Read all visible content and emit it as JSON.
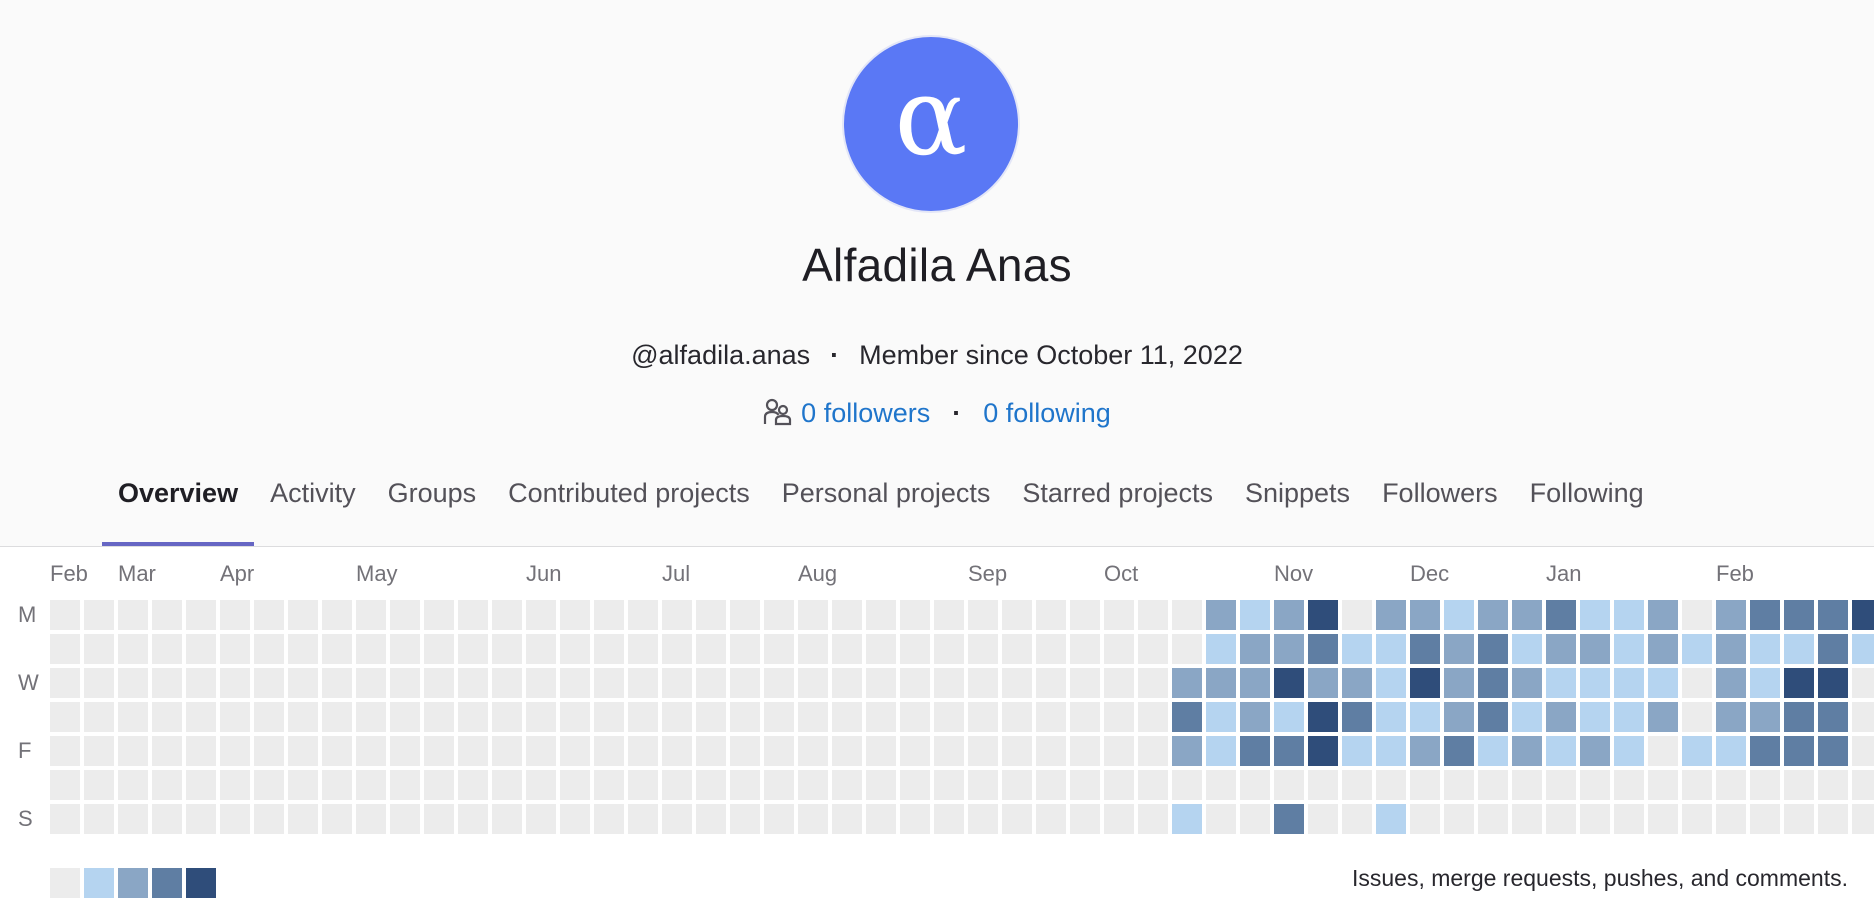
{
  "profile": {
    "avatar_letter": "α",
    "avatar_color": "#5a78f5",
    "name": "Alfadila Anas",
    "username": "@alfadila.anas",
    "member_since": "Member since October 11, 2022",
    "followers": "0 followers",
    "following": "0 following"
  },
  "tabs": [
    {
      "label": "Overview",
      "active": true
    },
    {
      "label": "Activity"
    },
    {
      "label": "Groups"
    },
    {
      "label": "Contributed projects"
    },
    {
      "label": "Personal projects"
    },
    {
      "label": "Starred projects"
    },
    {
      "label": "Snippets"
    },
    {
      "label": "Followers"
    },
    {
      "label": "Following"
    }
  ],
  "calendar": {
    "months": [
      {
        "label": "Feb",
        "week": 0
      },
      {
        "label": "Mar",
        "week": 2
      },
      {
        "label": "Apr",
        "week": 5
      },
      {
        "label": "May",
        "week": 9
      },
      {
        "label": "Jun",
        "week": 14
      },
      {
        "label": "Jul",
        "week": 18
      },
      {
        "label": "Aug",
        "week": 22
      },
      {
        "label": "Sep",
        "week": 27
      },
      {
        "label": "Oct",
        "week": 31
      },
      {
        "label": "Nov",
        "week": 36
      },
      {
        "label": "Dec",
        "week": 40
      },
      {
        "label": "Jan",
        "week": 44
      },
      {
        "label": "Feb",
        "week": 49
      }
    ],
    "day_labels": [
      {
        "label": "M",
        "row": 0
      },
      {
        "label": "W",
        "row": 2
      },
      {
        "label": "F",
        "row": 4
      },
      {
        "label": "S",
        "row": 6
      }
    ],
    "level_colors": [
      "#ececec",
      "#b5d4f0",
      "#8aa6c5",
      "#5f7ea3",
      "#2f4d7a"
    ],
    "levels_by_week": [
      [
        0,
        0,
        0,
        0,
        0,
        0,
        0
      ],
      [
        0,
        0,
        0,
        0,
        0,
        0,
        0
      ],
      [
        0,
        0,
        0,
        0,
        0,
        0,
        0
      ],
      [
        0,
        0,
        0,
        0,
        0,
        0,
        0
      ],
      [
        0,
        0,
        0,
        0,
        0,
        0,
        0
      ],
      [
        0,
        0,
        0,
        0,
        0,
        0,
        0
      ],
      [
        0,
        0,
        0,
        0,
        0,
        0,
        0
      ],
      [
        0,
        0,
        0,
        0,
        0,
        0,
        0
      ],
      [
        0,
        0,
        0,
        0,
        0,
        0,
        0
      ],
      [
        0,
        0,
        0,
        0,
        0,
        0,
        0
      ],
      [
        0,
        0,
        0,
        0,
        0,
        0,
        0
      ],
      [
        0,
        0,
        0,
        0,
        0,
        0,
        0
      ],
      [
        0,
        0,
        0,
        0,
        0,
        0,
        0
      ],
      [
        0,
        0,
        0,
        0,
        0,
        0,
        0
      ],
      [
        0,
        0,
        0,
        0,
        0,
        0,
        0
      ],
      [
        0,
        0,
        0,
        0,
        0,
        0,
        0
      ],
      [
        0,
        0,
        0,
        0,
        0,
        0,
        0
      ],
      [
        0,
        0,
        0,
        0,
        0,
        0,
        0
      ],
      [
        0,
        0,
        0,
        0,
        0,
        0,
        0
      ],
      [
        0,
        0,
        0,
        0,
        0,
        0,
        0
      ],
      [
        0,
        0,
        0,
        0,
        0,
        0,
        0
      ],
      [
        0,
        0,
        0,
        0,
        0,
        0,
        0
      ],
      [
        0,
        0,
        0,
        0,
        0,
        0,
        0
      ],
      [
        0,
        0,
        0,
        0,
        0,
        0,
        0
      ],
      [
        0,
        0,
        0,
        0,
        0,
        0,
        0
      ],
      [
        0,
        0,
        0,
        0,
        0,
        0,
        0
      ],
      [
        0,
        0,
        0,
        0,
        0,
        0,
        0
      ],
      [
        0,
        0,
        0,
        0,
        0,
        0,
        0
      ],
      [
        0,
        0,
        0,
        0,
        0,
        0,
        0
      ],
      [
        0,
        0,
        0,
        0,
        0,
        0,
        0
      ],
      [
        0,
        0,
        0,
        0,
        0,
        0,
        0
      ],
      [
        0,
        0,
        0,
        0,
        0,
        0,
        0
      ],
      [
        0,
        0,
        0,
        0,
        0,
        0,
        0
      ],
      [
        0,
        0,
        2,
        3,
        2,
        0,
        1
      ],
      [
        2,
        1,
        2,
        1,
        1,
        0,
        0
      ],
      [
        1,
        2,
        2,
        2,
        3,
        0,
        0
      ],
      [
        2,
        2,
        4,
        1,
        3,
        0,
        3
      ],
      [
        4,
        3,
        2,
        4,
        4,
        0,
        0
      ],
      [
        0,
        1,
        2,
        3,
        1,
        0,
        0
      ],
      [
        2,
        1,
        1,
        1,
        1,
        0,
        1
      ],
      [
        2,
        3,
        4,
        1,
        2,
        0,
        0
      ],
      [
        1,
        2,
        2,
        2,
        3,
        0,
        0
      ],
      [
        2,
        3,
        3,
        3,
        1,
        0,
        0
      ],
      [
        2,
        1,
        2,
        1,
        2,
        0,
        0
      ],
      [
        3,
        2,
        1,
        2,
        1,
        0,
        0
      ],
      [
        1,
        2,
        1,
        1,
        2,
        0,
        0
      ],
      [
        1,
        1,
        1,
        1,
        1,
        0,
        0
      ],
      [
        2,
        2,
        1,
        2,
        0,
        0,
        0
      ],
      [
        0,
        1,
        0,
        0,
        1,
        0,
        0
      ],
      [
        2,
        2,
        2,
        2,
        1,
        0,
        0
      ],
      [
        3,
        1,
        1,
        2,
        3,
        0,
        0
      ],
      [
        3,
        1,
        4,
        3,
        3,
        0,
        0
      ],
      [
        3,
        3,
        4,
        3,
        3,
        0,
        0
      ],
      [
        4,
        1,
        0,
        0,
        0,
        0,
        0
      ]
    ],
    "caption": "Issues, merge requests, pushes, and comments."
  }
}
